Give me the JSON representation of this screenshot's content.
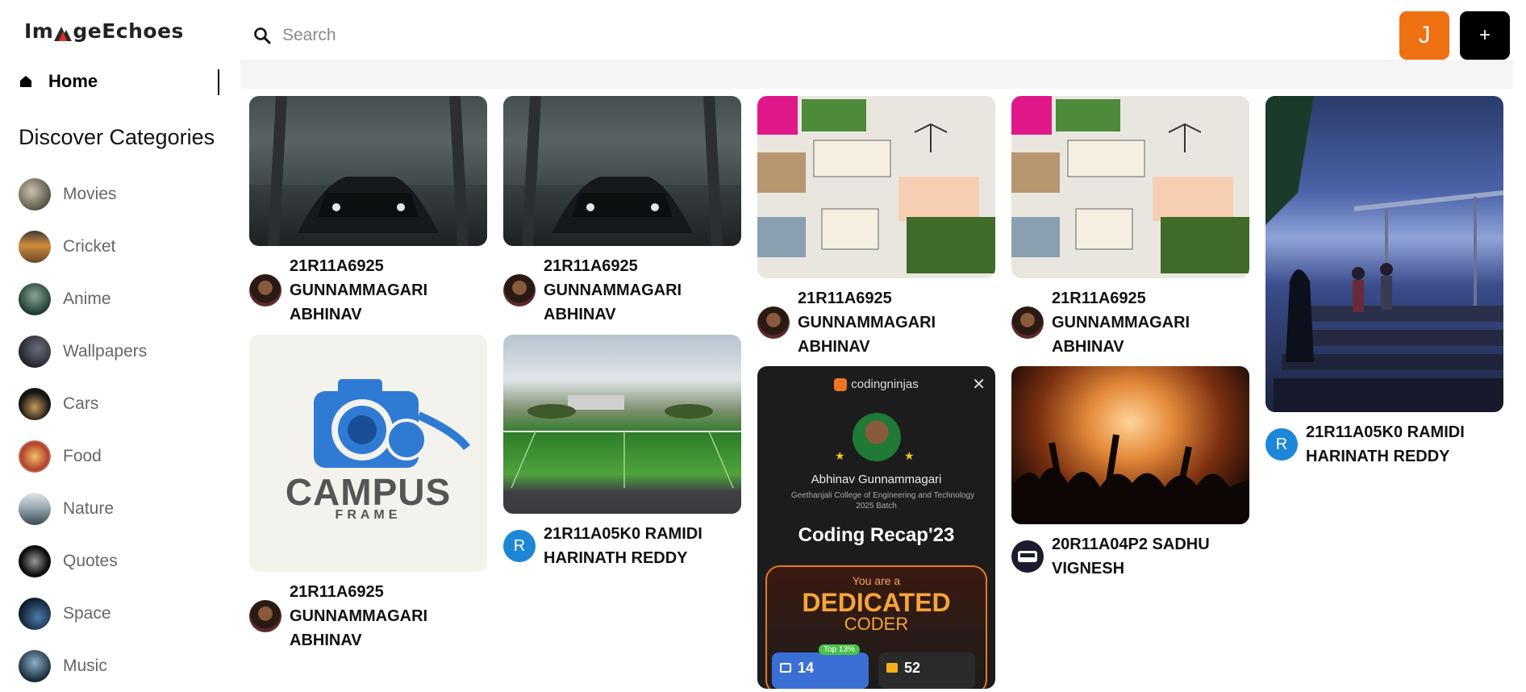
{
  "app": {
    "logo_text_left": "Im",
    "logo_text_right": "geEchoes"
  },
  "nav": {
    "home_label": "Home"
  },
  "sidebar": {
    "heading": "Discover Categories",
    "categories": [
      {
        "label": "Movies",
        "color": "#7a7466"
      },
      {
        "label": "Cricket",
        "color": "#9a6a3a"
      },
      {
        "label": "Anime",
        "color": "#2f4a3a"
      },
      {
        "label": "Wallpapers",
        "color": "#3b3f48"
      },
      {
        "label": "Cars",
        "color": "#2a2a2a"
      },
      {
        "label": "Food",
        "color": "#b45a2a"
      },
      {
        "label": "Nature",
        "color": "#8fa0a8"
      },
      {
        "label": "Quotes",
        "color": "#1e1e1e"
      },
      {
        "label": "Space",
        "color": "#2a4a6a"
      },
      {
        "label": "Music",
        "color": "#4a6a8a"
      }
    ]
  },
  "search": {
    "placeholder": "Search",
    "value": ""
  },
  "user": {
    "initial": "J"
  },
  "add_button": {
    "label": "+"
  },
  "pins": [
    {
      "author": "21R11A6925 GUNNAMMAGARI ABHINAV",
      "image": "dark-car"
    },
    {
      "author": "21R11A6925 GUNNAMMAGARI ABHINAV",
      "image": "dark-car"
    },
    {
      "author": "21R11A6925 GUNNAMMAGARI ABHINAV",
      "image": "inequality-infographic"
    },
    {
      "author": "21R11A6925 GUNNAMMAGARI ABHINAV",
      "image": "inequality-infographic"
    },
    {
      "author": "21R11A05K0 RAMIDI HARINATH REDDY",
      "avatar_initial": "R",
      "image": "concert-stage"
    },
    {
      "author": "21R11A6925 GUNNAMMAGARI ABHINAV",
      "image": "campus-frame-logo",
      "logo_title": "CAMPUS",
      "logo_sub": "FRAME"
    },
    {
      "author": "21R11A05K0 RAMIDI HARINATH REDDY",
      "avatar_initial": "R",
      "image": "football-field"
    },
    {
      "image": "coding-recap",
      "brand": "codingninjas",
      "person": "Abhinav Gunnammagari",
      "college": "Geethanjali College of Engineering and Technology",
      "batch": "2025 Batch",
      "title": "Coding Recap'23",
      "you_are": "You are a",
      "badge_line1": "DEDICATED",
      "badge_line2": "CODER",
      "top_tag": "Top 13%",
      "stat1": "14",
      "stat2": "52"
    },
    {
      "author": "20R11A04P2 SADHU VIGNESH",
      "image": "concert-crowd"
    }
  ]
}
